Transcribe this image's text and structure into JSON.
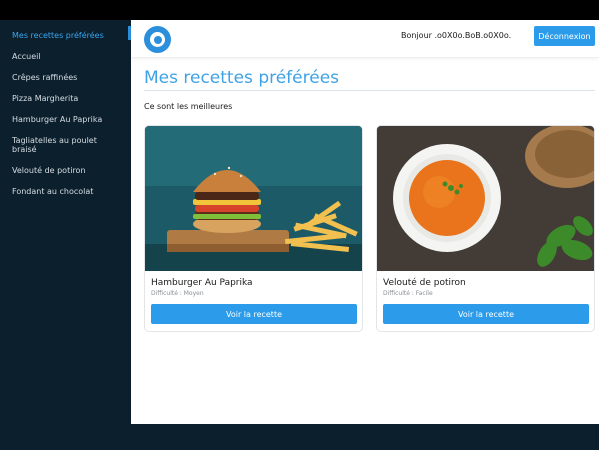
{
  "sidebar": {
    "items": [
      {
        "label": "Mes recettes préférées",
        "active": true
      },
      {
        "label": "Accueil"
      },
      {
        "label": "Crêpes raffinées"
      },
      {
        "label": "Pizza Margherita"
      },
      {
        "label": "Hamburger Au Paprika"
      },
      {
        "label": "Tagliatelles au poulet braisé"
      },
      {
        "label": "Velouté de potiron"
      },
      {
        "label": "Fondant au chocolat"
      }
    ]
  },
  "header": {
    "greeting": "Bonjour .o0X0o.BoB.o0X0o.",
    "logout_label": "Déconnexion"
  },
  "main": {
    "title": "Mes recettes préférées",
    "subtitle": "Ce sont les meilleures",
    "cards": [
      {
        "name": "Hamburger Au Paprika",
        "difficulty": "Difficulté : Moyen",
        "button": "Voir la recette",
        "image": "burger-with-fries"
      },
      {
        "name": "Velouté de potiron",
        "difficulty": "Difficulté : Facile",
        "button": "Voir la recette",
        "image": "pumpkin-soup-bowl"
      }
    ]
  },
  "colors": {
    "accent": "#2b9bea",
    "sidebar_bg": "#0b1f2d",
    "active_link": "#39a5ef"
  }
}
